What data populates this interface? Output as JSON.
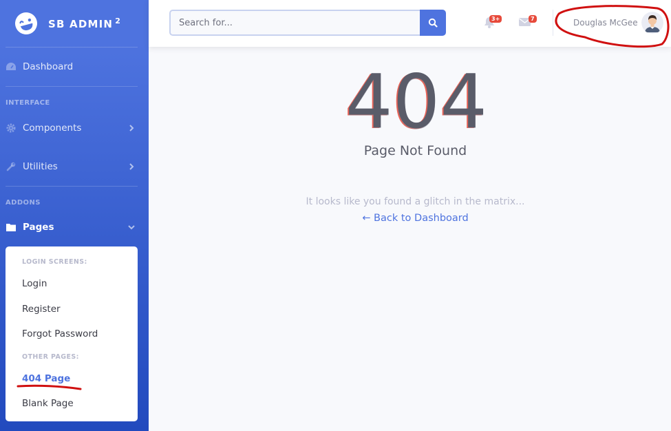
{
  "sidebar": {
    "brand": "SB ADMIN",
    "brand_sup": "2",
    "dashboard": "Dashboard",
    "heading_interface": "INTERFACE",
    "components": "Components",
    "utilities": "Utilities",
    "heading_addons": "ADDONS",
    "pages": "Pages",
    "collapse": {
      "login_heading": "LOGIN SCREENS:",
      "login": "Login",
      "register": "Register",
      "forgot": "Forgot Password",
      "other_heading": "OTHER PAGES:",
      "page404": "404 Page",
      "blank": "Blank Page"
    }
  },
  "topbar": {
    "search_placeholder": "Search for...",
    "alerts_badge": "3+",
    "messages_badge": "7",
    "user_name": "Douglas McGee"
  },
  "main": {
    "code": "404",
    "title": "Page Not Found",
    "message": "It looks like you found a glitch in the matrix...",
    "back_link": "← Back to Dashboard"
  },
  "colors": {
    "primary": "#4e73df",
    "danger": "#e74a3b",
    "annotation": "#d01010"
  }
}
